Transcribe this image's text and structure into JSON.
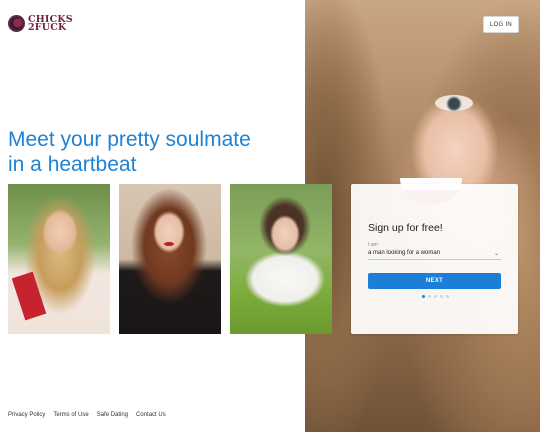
{
  "brand": {
    "line1": "CHICKS",
    "line2": "2FUCK"
  },
  "header": {
    "login_label": "LOG IN"
  },
  "hero": {
    "headline_line1": "Meet your pretty soulmate",
    "headline_line2": "in a heartbeat"
  },
  "signup": {
    "title": "Sign up for free!",
    "field_label": "I am",
    "select_value": "a man looking for a woman",
    "next_label": "NEXT",
    "step_current": 1,
    "step_total": 5
  },
  "footer": {
    "links": [
      "Privacy Policy",
      "Terms of Use",
      "Safe Dating",
      "Contact Us"
    ]
  },
  "colors": {
    "accent": "#1b7fd8",
    "headline": "#1f82d4",
    "brand": "#6b2442"
  }
}
